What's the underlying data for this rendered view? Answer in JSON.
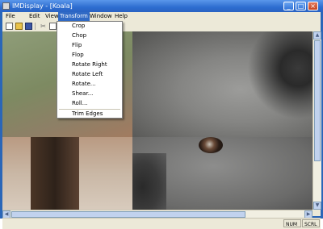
{
  "window": {
    "title": "IMDisplay - [Koala]"
  },
  "menubar": [
    "File",
    "Edit",
    "View",
    "Transform",
    "Window",
    "Help"
  ],
  "transform_menu": {
    "items": [
      "Crop",
      "Chop",
      "Flip",
      "Flop",
      "Rotate Right",
      "Rotate Left",
      "Rotate...",
      "Shear...",
      "Roll...",
      "Trim Edges"
    ]
  },
  "toolbar": {
    "cut_glyph": "✂"
  },
  "statusbar": {
    "num": "NUM",
    "scrl": "SCRL"
  },
  "window_buttons": {
    "minimize": "_",
    "maximize": "□",
    "close": "×"
  },
  "colors": {
    "accent": "#316ac5",
    "titlebar": "#2d6dd0"
  }
}
